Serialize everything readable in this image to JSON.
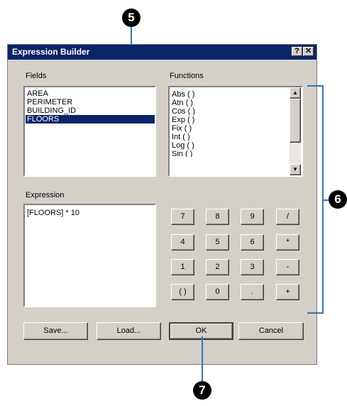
{
  "callouts": {
    "five": "5",
    "six": "6",
    "seven": "7"
  },
  "dialog": {
    "title": "Expression Builder",
    "help_glyph": "?",
    "close_glyph": "✕"
  },
  "fields": {
    "label": "Fields",
    "items": [
      "AREA",
      "PERIMETER",
      "BUILDING_ID",
      "FLOORS"
    ],
    "selected": "FLOORS"
  },
  "functions": {
    "label": "Functions",
    "items": [
      "Abs ( )",
      "Atn ( )",
      "Cos ( )",
      "Exp ( )",
      "Fix ( )",
      "Int ( )",
      "Log ( )",
      "Sin ( )"
    ],
    "scroll_up_glyph": "▲",
    "scroll_down_glyph": "▼"
  },
  "expression": {
    "label": "Expression",
    "value": "[FLOORS] * 10"
  },
  "keypad": {
    "keys": [
      "7",
      "8",
      "9",
      "/",
      "4",
      "5",
      "6",
      "*",
      "1",
      "2",
      "3",
      "-",
      "( )",
      "0",
      ".",
      "+"
    ]
  },
  "buttons": {
    "save": "Save...",
    "load": "Load...",
    "ok": "OK",
    "cancel": "Cancel"
  },
  "colors": {
    "title_bar": "#0a246a",
    "selection": "#0a246a",
    "dialog_face": "#d4d0c8",
    "callout_line": "#2f78b5"
  }
}
